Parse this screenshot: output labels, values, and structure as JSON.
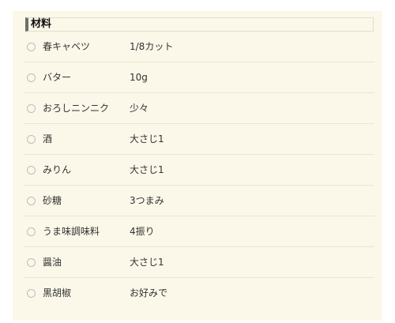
{
  "heading": "材料",
  "ingredients": [
    {
      "name": "春キャベツ",
      "amount": "1/8カット"
    },
    {
      "name": "バター",
      "amount": "10g"
    },
    {
      "name": "おろしニンニク",
      "amount": "少々"
    },
    {
      "name": "酒",
      "amount": "大さじ1"
    },
    {
      "name": "みりん",
      "amount": "大さじ1"
    },
    {
      "name": "砂糖",
      "amount": "3つまみ"
    },
    {
      "name": "うま味調味料",
      "amount": "4振り"
    },
    {
      "name": "醤油",
      "amount": "大さじ1"
    },
    {
      "name": "黒胡椒",
      "amount": "お好みで"
    }
  ]
}
